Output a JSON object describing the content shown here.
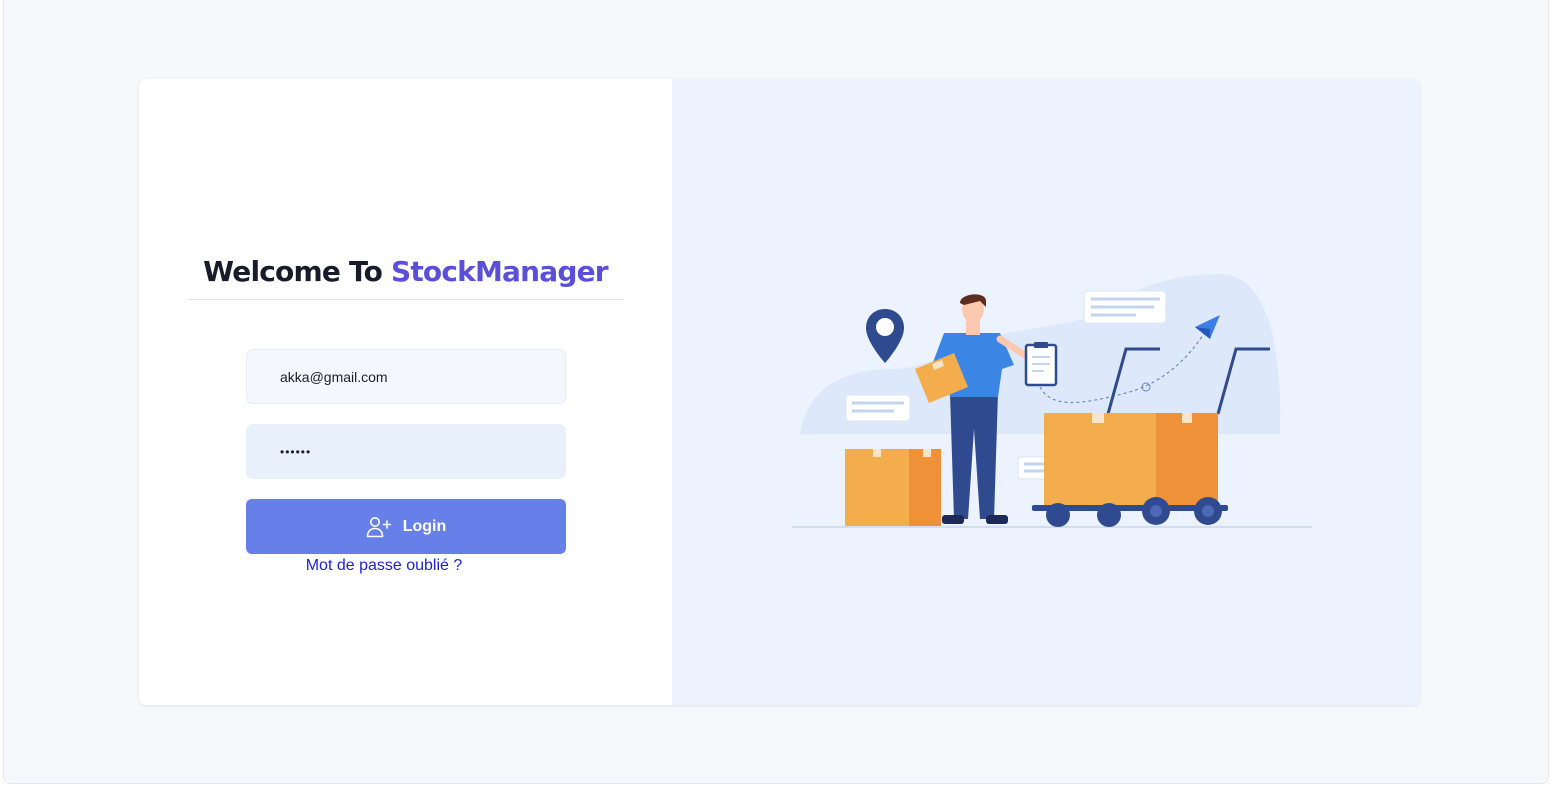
{
  "login": {
    "title_prefix": "Welcome To",
    "title_brand": "StockManager",
    "email_value": "akka@gmail.com",
    "password_value": "••••••",
    "login_button_label": "Login",
    "login_button_icon": "user-plus-icon",
    "forgot_password_link": "Mot de passe oublié ?"
  },
  "illustration": {
    "subject": "warehouse-worker-with-boxes-and-carts",
    "icons": [
      "location-pin-icon",
      "paper-plane-icon",
      "clipboard-icon"
    ]
  },
  "colors": {
    "brand": "#5b4fd9",
    "button": "#677fe9",
    "link": "#1f1fd0",
    "right_panel_bg": "#ecf3fe",
    "page_bg": "#f6f9fc"
  }
}
